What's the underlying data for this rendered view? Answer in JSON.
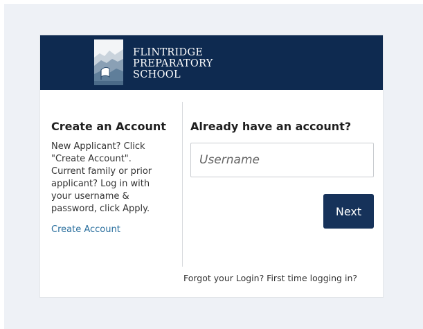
{
  "school": {
    "line1": "FLINTRIDGE",
    "line2": "PREPARATORY",
    "line3": "SCHOOL"
  },
  "create": {
    "heading": "Create an Account",
    "description": "New Applicant? Click \"Create Account\". Current family or prior applicant? Log in with your username & password, click Apply.",
    "link": "Create Account"
  },
  "login": {
    "heading": "Already have an account?",
    "username_placeholder": "Username",
    "username_value": "",
    "next_label": "Next",
    "forgot_link": "Forgot your Login? First time logging in?"
  },
  "colors": {
    "banner": "#0e2a50",
    "button": "#16325a",
    "link": "#2a6f9e",
    "page_bg": "#eef1f6"
  }
}
